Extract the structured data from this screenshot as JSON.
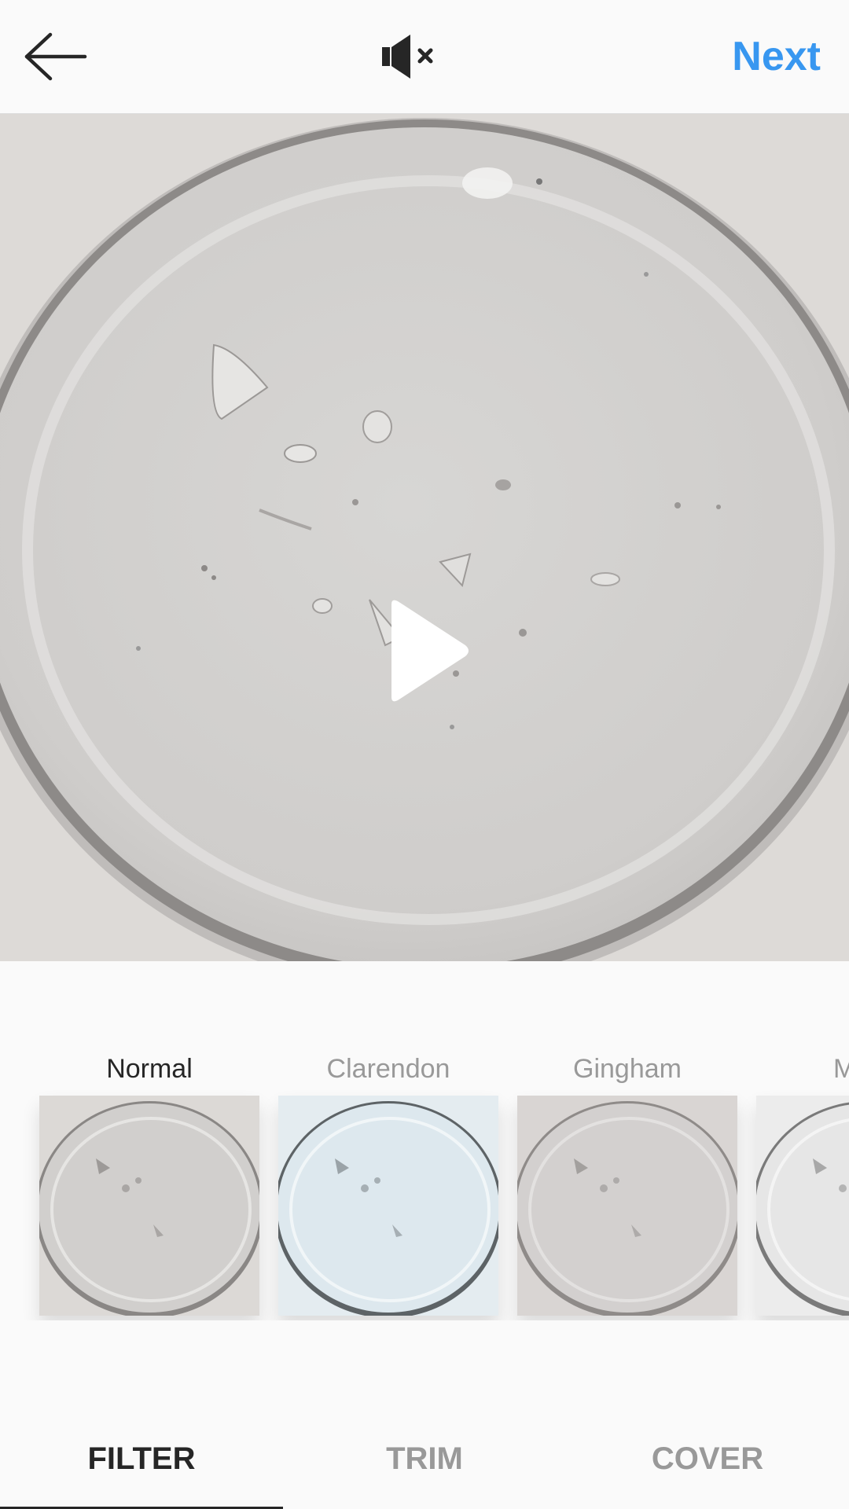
{
  "header": {
    "back_icon": "arrow-left-icon",
    "mute_icon": "speaker-muted-icon",
    "next_label": "Next",
    "accent_color": "#3897f0"
  },
  "video": {
    "play_icon": "play-icon",
    "description_icon": "clear-gel-droplet"
  },
  "filters": [
    {
      "name": "Normal",
      "selected": true,
      "tint": "#dcd9d6"
    },
    {
      "name": "Clarendon",
      "selected": false,
      "tint": "#dde8ee"
    },
    {
      "name": "Gingham",
      "selected": false,
      "tint": "#d9d6d5"
    },
    {
      "name": "Moon",
      "selected": false,
      "tint": "#e8e8e8"
    }
  ],
  "tabs": [
    {
      "label": "FILTER",
      "active": true
    },
    {
      "label": "TRIM",
      "active": false
    },
    {
      "label": "COVER",
      "active": false
    }
  ]
}
